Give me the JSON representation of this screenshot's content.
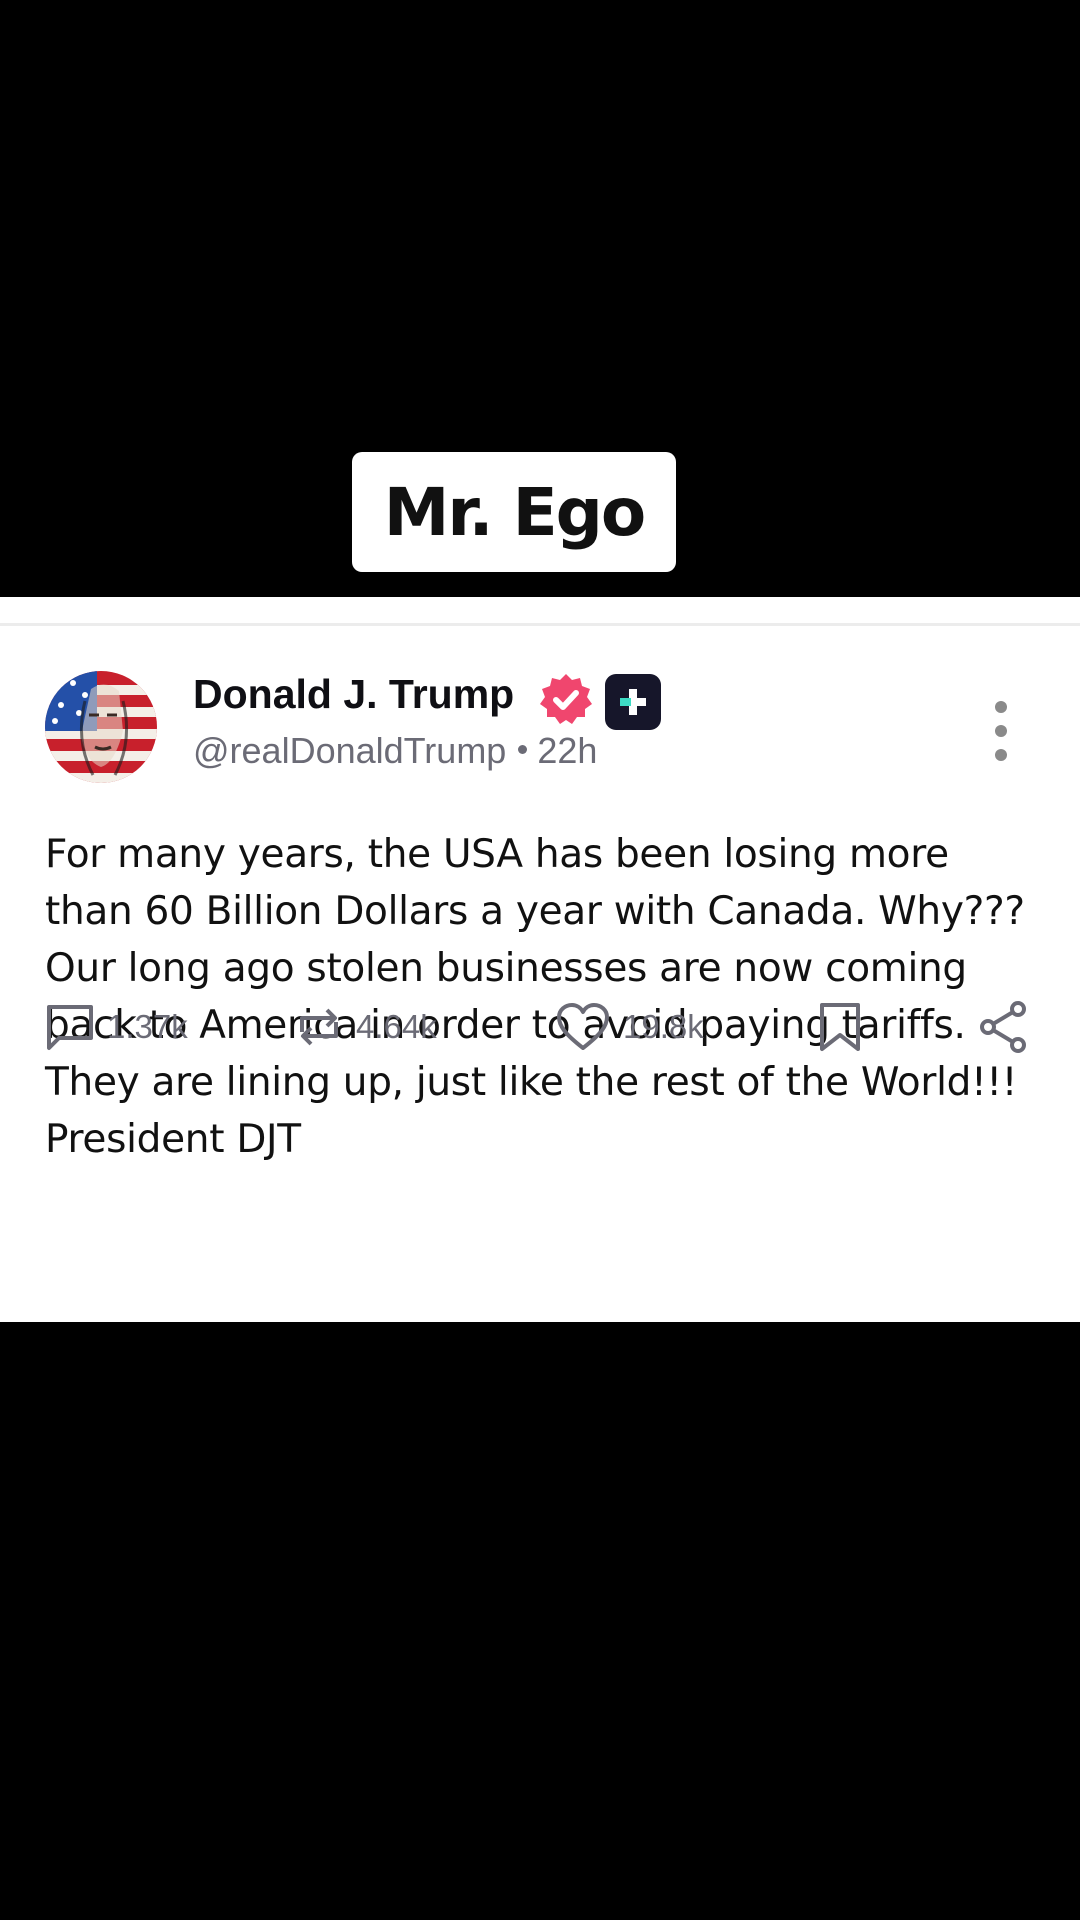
{
  "caption": {
    "text": "Mr. Ego"
  },
  "post": {
    "author": {
      "display_name": "Donald J. Trump",
      "handle": "@realDonaldTrump",
      "verified_badge_color": "#f0466e",
      "plus_badge_color": "#16162a",
      "plus_badge_accent": "#3ddbc4"
    },
    "timestamp": "22h",
    "body": "For many years, the USA has been losing more than 60 Billion Dollars a year with Canada. Why??? Our long ago stolen businesses are now coming back to America in order to avoid paying tariffs. They are lining up, just like the rest of the World!!! President DJT",
    "stats": {
      "replies": "1.37k",
      "reposts": "4.64k",
      "likes": "19.8k"
    },
    "actions": {
      "reply_icon": "comment-icon",
      "repost_icon": "repost-icon",
      "like_icon": "heart-icon",
      "bookmark_icon": "bookmark-icon",
      "share_icon": "share-icon",
      "more_icon": "more-vertical-icon"
    }
  },
  "colors": {
    "background": "#000000",
    "card": "#ffffff",
    "text": "#111111",
    "muted_text": "#6b6b76"
  }
}
